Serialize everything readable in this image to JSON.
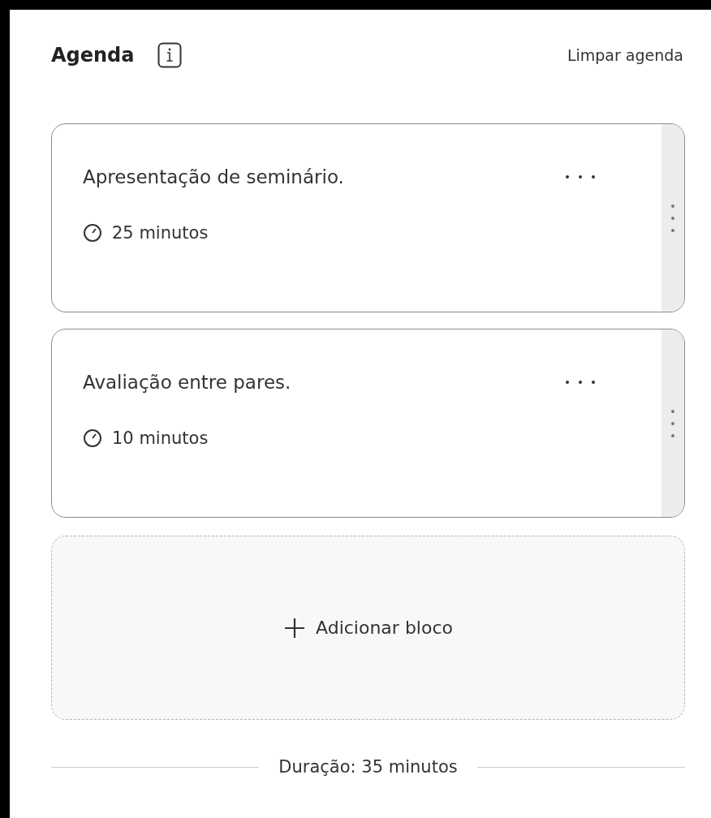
{
  "header": {
    "title": "Agenda",
    "clear_link": "Limpar agenda"
  },
  "blocks": [
    {
      "title": "Apresentação de seminário.",
      "duration": "25 minutos"
    },
    {
      "title": "Avaliação entre pares.",
      "duration": "10 minutos"
    }
  ],
  "add_block": {
    "label": "Adicionar bloco"
  },
  "total": "Duração: 35 minutos"
}
